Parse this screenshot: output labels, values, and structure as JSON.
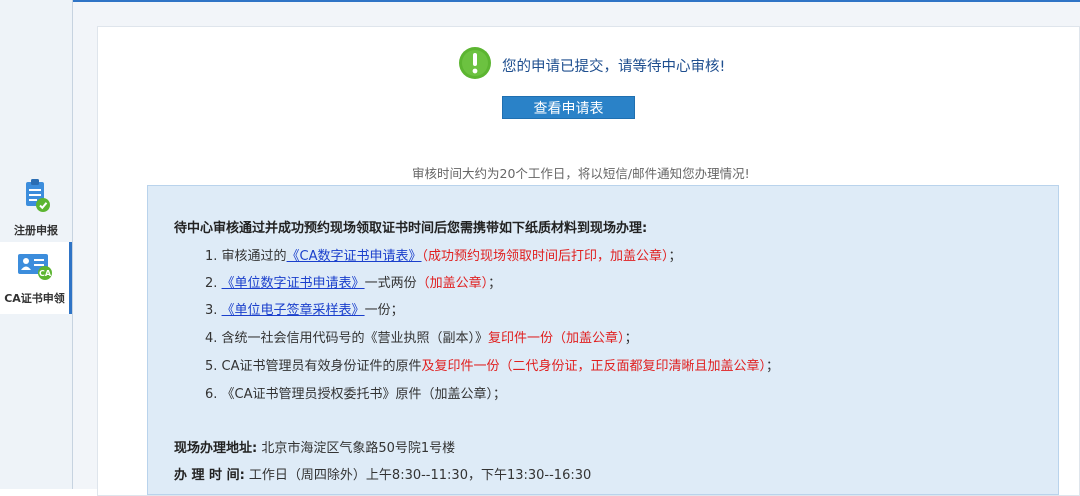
{
  "sidebar": {
    "items": [
      {
        "label": "注册申报",
        "icon": "document-check-icon",
        "active": false
      },
      {
        "label": "CA证书申领",
        "icon": "ca-certificate-icon",
        "active": true
      }
    ]
  },
  "status": {
    "icon": "exclamation-circle-icon",
    "message": "您的申请已提交，请等待中心审核!",
    "view_button": "查看申请表"
  },
  "review_note": "审核时间大约为20个工作日，将以短信/邮件通知您办理情况!",
  "info": {
    "title": "待中心审核通过并成功预约现场领取证书时间后您需携带如下纸质材料到现场办理:",
    "items": [
      {
        "prefix": "1. 审核通过的",
        "link": "《CA数字证书申请表》",
        "mid": "",
        "red": "（成功预约现场领取时间后打印，加盖公章）",
        "suffix": "；"
      },
      {
        "prefix": "2. ",
        "link": "《单位数字证书申请表》",
        "mid": "一式两份",
        "red": "（加盖公章）",
        "suffix": "；"
      },
      {
        "prefix": "3. ",
        "link": "《单位电子签章采样表》",
        "mid": "一份；",
        "red": "",
        "suffix": ""
      },
      {
        "prefix": "4. 含统一社会信用代码号的《营业执照（副本）》",
        "link": "",
        "mid": "",
        "red": "复印件一份（加盖公章）",
        "suffix": "；"
      },
      {
        "prefix": "5. CA证书管理员有效身份证件的原件",
        "link": "",
        "mid": "",
        "red": "及复印件一份（二代身份证，正反面都复印清晰且加盖公章）",
        "suffix": "；"
      },
      {
        "prefix": "6. 《CA证书管理员授权委托书》原件（加盖公章）；",
        "link": "",
        "mid": "",
        "red": "",
        "suffix": ""
      }
    ],
    "address_label": "现场办理地址:",
    "address_value": "北京市海淀区气象路50号院1号楼",
    "hours_label": "办 理 时 间:",
    "hours_value": "工作日（周四除外）上午8:30--11:30，下午13:30--16:30"
  },
  "colors": {
    "accent": "#2a82c8",
    "link": "#1a3fcc",
    "warning_red": "#e02020",
    "success_green": "#5cb531",
    "info_bg": "#deebf7"
  }
}
